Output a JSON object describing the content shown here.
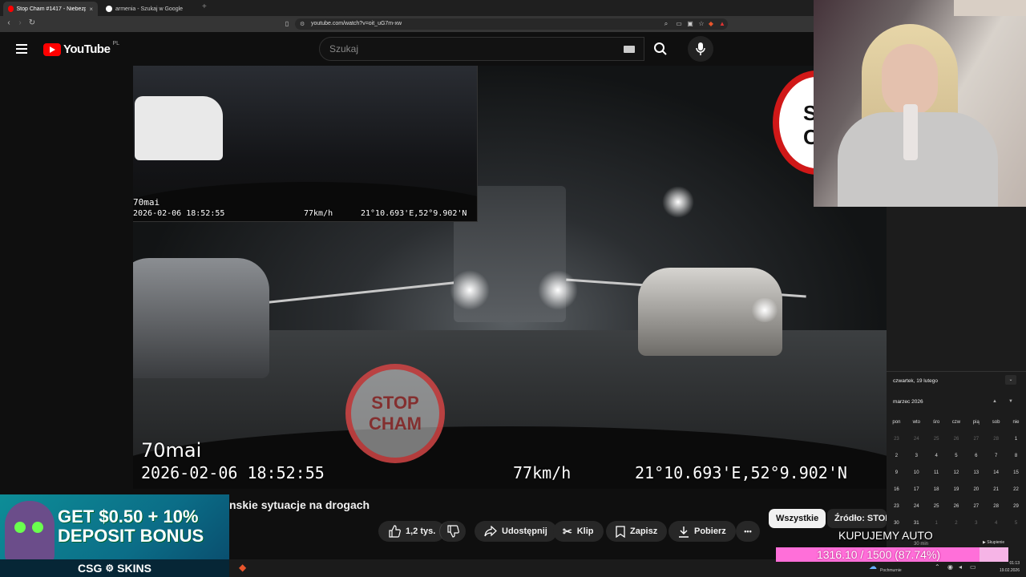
{
  "browser": {
    "tabs": [
      {
        "label": "Stop Cham #1417 - Niebezpiecz...",
        "active": true
      },
      {
        "label": "armenia - Szukaj w Google",
        "active": false
      }
    ],
    "url": "youtube.com/watch?v=oit_uG7m-xw"
  },
  "youtube": {
    "logo_text": "YouTube",
    "region": "PL",
    "search_placeholder": "Szukaj"
  },
  "video": {
    "inset_brand": "70mai",
    "inset_timestamp": "2026-02-06  18:52:55",
    "inset_speed": "77km/h",
    "inset_gps": "21°10.693'E,52°9.902'N",
    "brand": "70mai",
    "timestamp": "2026-02-06  18:52:55",
    "speed": "77km/h",
    "gps": "21°10.693'E,52°9.902'N",
    "stamp_line1": "STOP",
    "stamp_line2": "CHAM",
    "corner_stamp_line1": "ST",
    "corner_stamp_line2": "CH",
    "title": "nskie sytuacje na drogach"
  },
  "actions": {
    "likes": "1,2 tys.",
    "share": "Udostępnij",
    "clip": "Klip",
    "save": "Zapisz",
    "download": "Pobierz",
    "more": "•••"
  },
  "chips": {
    "all": "Wszystkie",
    "source": "Źródło: STOP"
  },
  "ad": {
    "line1": "GET $0.50 + 10%",
    "line2": "DEPOSIT BONUS",
    "brand": "CSG",
    "brand2": "SKINS"
  },
  "calendar": {
    "date_header": "czwartek, 19 lutego",
    "month": "marzec 2026",
    "weekdays": [
      "pon",
      "wto",
      "śro",
      "czw",
      "pią",
      "sob",
      "nie"
    ],
    "weeks": [
      [
        "23",
        "24",
        "25",
        "26",
        "27",
        "28",
        "1"
      ],
      [
        "2",
        "3",
        "4",
        "5",
        "6",
        "7",
        "8"
      ],
      [
        "9",
        "10",
        "11",
        "12",
        "13",
        "14",
        "15"
      ],
      [
        "16",
        "17",
        "18",
        "19",
        "20",
        "21",
        "22"
      ],
      [
        "23",
        "24",
        "25",
        "26",
        "27",
        "28",
        "29"
      ],
      [
        "30",
        "31",
        "1",
        "2",
        "3",
        "4",
        "5"
      ]
    ],
    "focus_label": "30 min",
    "focus_button": "Skupienie"
  },
  "taskbar": {
    "weather": "Pochmurnie",
    "time": "01:13",
    "date": "19.02.2026"
  },
  "stream_overlay": {
    "banner": "KUPUJEMY AUTO",
    "goal_text": "1316.10 / 1500 (87.74%)",
    "goal_fraction": 0.8774
  },
  "colors": {
    "youtube_red": "#ff0000",
    "goal_pink": "#ff6fd9",
    "ad_teal": "#0d8d97"
  }
}
